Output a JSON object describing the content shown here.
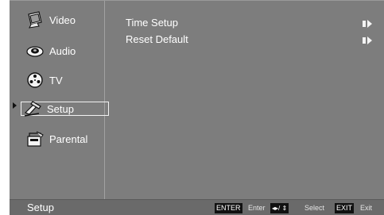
{
  "menu": {
    "items": [
      {
        "label": "Video",
        "icon": "video-tv-icon"
      },
      {
        "label": "Audio",
        "icon": "audio-speaker-icon"
      },
      {
        "label": "TV",
        "icon": "tv-reel-icon"
      },
      {
        "label": "Setup",
        "icon": "setup-tools-icon",
        "selected": true
      },
      {
        "label": "Parental",
        "icon": "parental-lock-icon"
      }
    ]
  },
  "content": {
    "rows": [
      {
        "label": "Time Setup",
        "icon": "submenu-arrow-icon"
      },
      {
        "label": "Reset Default",
        "icon": "submenu-arrow-icon"
      }
    ]
  },
  "footer": {
    "title": "Setup",
    "enter_key": "ENTER",
    "enter_desc": "Enter",
    "select_key": "◂▸/ ⇕",
    "select_desc": "Select",
    "exit_key": "EXIT",
    "exit_desc": "Exit"
  },
  "colors": {
    "background": "#7d7d7d",
    "footer": "#6a6a6a",
    "text": "#ffffff"
  }
}
